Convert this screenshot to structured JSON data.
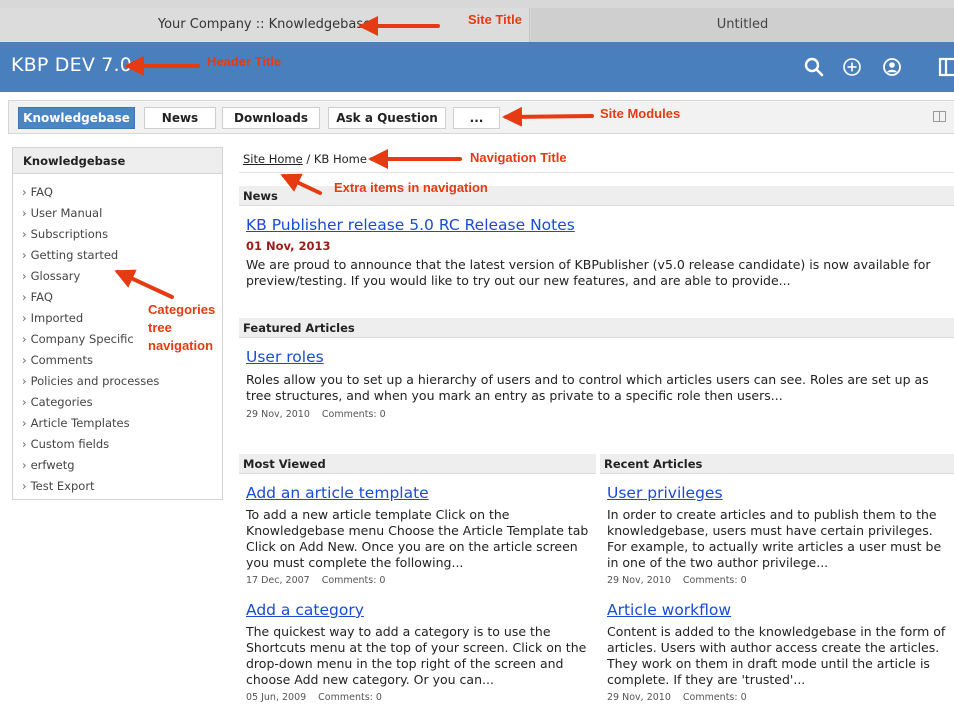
{
  "browser": {
    "active_tab": "Your Company :: Knowledgebase",
    "inactive_tab": "Untitled"
  },
  "header": {
    "title": "KBP DEV 7.0",
    "icons": [
      "search-icon",
      "add-circle-icon",
      "user-circle-icon",
      "panel-icon"
    ]
  },
  "modules": {
    "items": [
      "Knowledgebase",
      "News",
      "Downloads",
      "Ask a Question",
      "..."
    ],
    "active": "Knowledgebase"
  },
  "sidebar": {
    "title": "Knowledgebase",
    "items": [
      "FAQ",
      "User Manual",
      "Subscriptions",
      "Getting started",
      "Glossary",
      "FAQ",
      "Imported",
      "Company Specific",
      "Comments",
      "Policies and processes",
      "Categories",
      "Article Templates",
      "Custom fields",
      "erfwetg",
      "Test Export"
    ]
  },
  "breadcrumb": {
    "home": "Site Home",
    "separator": "/",
    "current": "KB Home"
  },
  "news": {
    "heading": "News",
    "title": "KB Publisher release 5.0 RC Release Notes",
    "date": "01 Nov, 2013",
    "body": "We are proud to announce that the latest version of KBPublisher (v5.0 release candidate) is now available for preview/testing. If you would like to try out our new features, and are able to provide..."
  },
  "featured": {
    "heading": "Featured Articles",
    "title": "User roles",
    "body": "Roles allow you to set up a hierarchy of users and to control which articles users can see. Roles are set up as tree structures, and when you mark an entry as private to a specific role then users...",
    "date": "29 Nov, 2010",
    "comments": "Comments: 0"
  },
  "most_viewed": {
    "heading": "Most Viewed",
    "articles": [
      {
        "title": "Add an article template",
        "body": "To add a new article template Click on the Knowledgebase menu Choose the Article Template tab Click on Add New. Once you are on the article screen you must complete the following...",
        "date": "17 Dec, 2007",
        "comments": "Comments: 0"
      },
      {
        "title": "Add a category",
        "body": "The quickest way to add a category is to use the Shortcuts menu at the top of your screen. Click on the drop-down menu in the top right of the screen and choose Add new category. Or you can...",
        "date": "05 Jun, 2009",
        "comments": "Comments: 0"
      }
    ]
  },
  "recent": {
    "heading": "Recent Articles",
    "articles": [
      {
        "title": "User privileges",
        "body": "In order to create articles and to publish them to the knowledgebase, users must have certain privileges. For example, to actually write articles a user must be in one of the two author privilege...",
        "date": "29 Nov, 2010",
        "comments": "Comments: 0"
      },
      {
        "title": "Article workflow",
        "body": "Content is added to the knowledgebase in the form of articles. Users with author access create the articles. They work on them in draft mode until the article is complete. If they are 'trusted'...",
        "date": "29 Nov, 2010",
        "comments": "Comments: 0"
      }
    ]
  },
  "annotations": {
    "site_title": "Site Title",
    "header_title": "Header Title",
    "site_modules": "Site Modules",
    "navigation_title": "Navigation Title",
    "extra_items": "Extra items in navigation",
    "categories_1": "Categories",
    "categories_2": "tree",
    "categories_3": "navigation",
    "color": "#e53a12"
  },
  "colors": {
    "header_bg": "#4a7fbd",
    "active_module": "#4a86c5",
    "link": "#1a4bd6",
    "news_date": "#9c1c1c"
  }
}
